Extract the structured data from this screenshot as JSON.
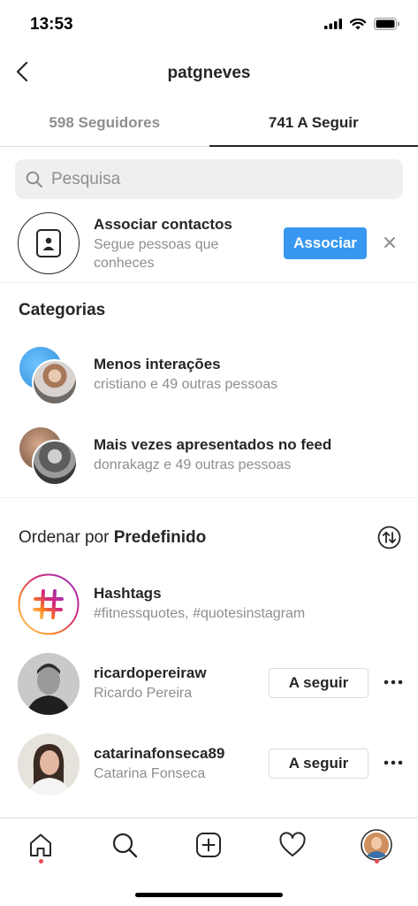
{
  "status": {
    "time": "13:53"
  },
  "header": {
    "title": "patgneves"
  },
  "tabs": [
    {
      "label": "598 Seguidores"
    },
    {
      "label": "741 A Seguir"
    }
  ],
  "search": {
    "placeholder": "Pesquisa"
  },
  "contacts": {
    "title": "Associar contactos",
    "subtitle": "Segue pessoas que conheces",
    "button": "Associar"
  },
  "categories": {
    "title": "Categorias",
    "items": [
      {
        "title": "Menos interações",
        "subtitle": "cristiano e 49 outras pessoas"
      },
      {
        "title": "Mais vezes apresentados no feed",
        "subtitle": "donrakagz e 49 outras pessoas"
      }
    ]
  },
  "sort": {
    "prefix": "Ordenar por",
    "value": "Predefinido"
  },
  "list": [
    {
      "name": "Hashtags",
      "subtitle": "#fitnessquotes, #quotesinstagram"
    },
    {
      "name": "ricardopereiraw",
      "subtitle": "Ricardo Pereira",
      "button": "A seguir"
    },
    {
      "name": "catarinafonseca89",
      "subtitle": "Catarina Fonseca",
      "button": "A seguir"
    }
  ],
  "icons": {
    "back": "chevron-left-icon",
    "search": "search-icon",
    "contacts": "contact-card-icon",
    "close": "close-icon",
    "sort": "sort-arrows-icon",
    "hashtag": "hashtag-icon",
    "more": "more-dots-icon",
    "home": "home-icon",
    "explore": "search-icon",
    "new_post": "plus-square-icon",
    "activity": "heart-icon"
  },
  "colors": {
    "accent": "#3897f0",
    "notification": "#ed4956",
    "secondary_text": "#8e8e8e"
  }
}
